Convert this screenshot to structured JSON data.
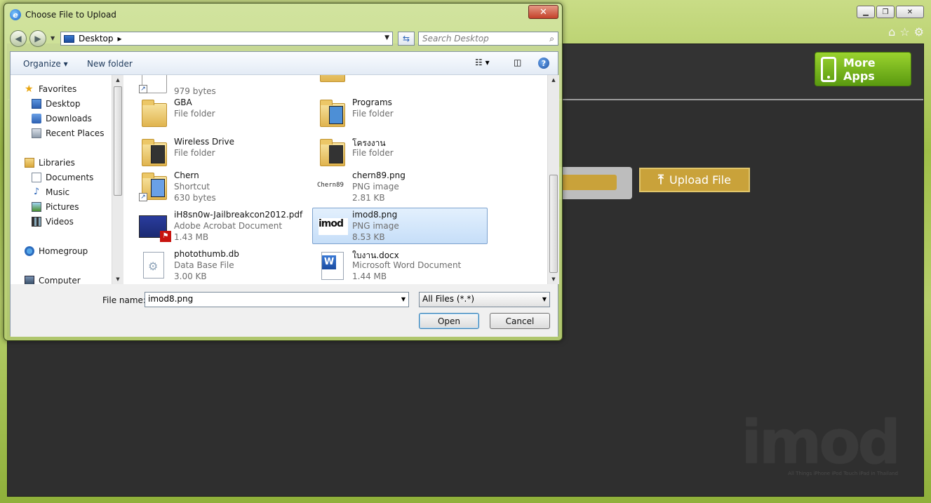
{
  "dialog": {
    "title": "Choose File to Upload",
    "close_glyph": "✕",
    "address": "Desktop",
    "search_placeholder": "Search Desktop",
    "toolbar": {
      "organize": "Organize ▾",
      "new_folder": "New folder",
      "help": "?"
    },
    "nav": {
      "favorites": "Favorites",
      "desktop": "Desktop",
      "downloads": "Downloads",
      "recent": "Recent Places",
      "libraries": "Libraries",
      "documents": "Documents",
      "music": "Music",
      "pictures": "Pictures",
      "videos": "Videos",
      "homegroup": "Homegroup",
      "computer": "Computer"
    },
    "files": [
      {
        "name": "",
        "type": "",
        "size": "979 bytes"
      },
      {
        "name": "",
        "type": "File folder",
        "size": ""
      },
      {
        "name": "GBA",
        "type": "File folder",
        "size": ""
      },
      {
        "name": "Programs",
        "type": "File folder",
        "size": ""
      },
      {
        "name": "Wireless Drive",
        "type": "File folder",
        "size": ""
      },
      {
        "name": "โครงงาน",
        "type": "File folder",
        "size": ""
      },
      {
        "name": "Chern",
        "type": "Shortcut",
        "size": "630 bytes"
      },
      {
        "name": "chern89.png",
        "type": "PNG image",
        "size": "2.81 KB"
      },
      {
        "name": "iH8sn0w-Jailbreakcon2012.pdf",
        "type": "Adobe Acrobat Document",
        "size": "1.43 MB"
      },
      {
        "name": "imod8.png",
        "type": "PNG image",
        "size": "8.53 KB"
      },
      {
        "name": "photothumb.db",
        "type": "Data Base File",
        "size": "3.00 KB"
      },
      {
        "name": "ใบงาน.docx",
        "type": "Microsoft Word Document",
        "size": "1.44 MB"
      }
    ],
    "thumb_labels": {
      "chern89": "Chern89",
      "imod8": "imod",
      "word": "W"
    },
    "file_name_label": "File name:",
    "file_name_value": "imod8.png",
    "filter_value": "All Files (*.*)",
    "open_label": "Open",
    "cancel_label": "Cancel"
  },
  "web": {
    "more_apps_label": "More Apps",
    "upload_label": "Upload File",
    "logo_text": "imod",
    "logo_tagline": "All Things iPhone iPod Touch iPad in Thailand"
  },
  "colors": {
    "accent_green": "#6aac1a",
    "upload_gold": "#c9a23a",
    "selection_blue": "#c6def8"
  }
}
